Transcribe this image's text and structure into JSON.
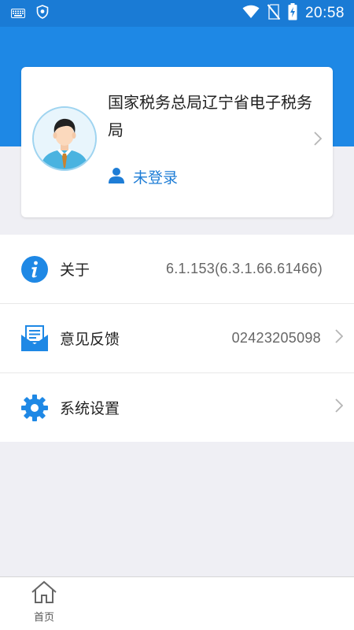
{
  "status_bar": {
    "time": "20:58",
    "left_icons": [
      "keyboard-icon",
      "shield-icon"
    ],
    "right_icons": [
      "wifi-icon",
      "no-sim-icon",
      "battery-charging-icon"
    ]
  },
  "profile": {
    "org_name": "国家税务总局辽宁省电子税务局",
    "login_status": "未登录",
    "avatar_icon": "avatar-icon",
    "person_icon": "person-icon"
  },
  "menu": {
    "items": [
      {
        "label": "关于",
        "value": "6.1.153(6.3.1.66.61466)",
        "icon": "info-icon",
        "chevron": false
      },
      {
        "label": "意见反馈",
        "value": "02423205098",
        "icon": "feedback-icon",
        "chevron": true
      },
      {
        "label": "系统设置",
        "value": "",
        "icon": "gear-icon",
        "chevron": true
      }
    ]
  },
  "bottom_nav": {
    "items": [
      {
        "label": "首页",
        "icon": "home-icon"
      }
    ]
  },
  "colors": {
    "status_bar": "#1a7bd5",
    "header": "#1e88e5",
    "accent": "#1e7dd6",
    "background": "#efeff4"
  }
}
